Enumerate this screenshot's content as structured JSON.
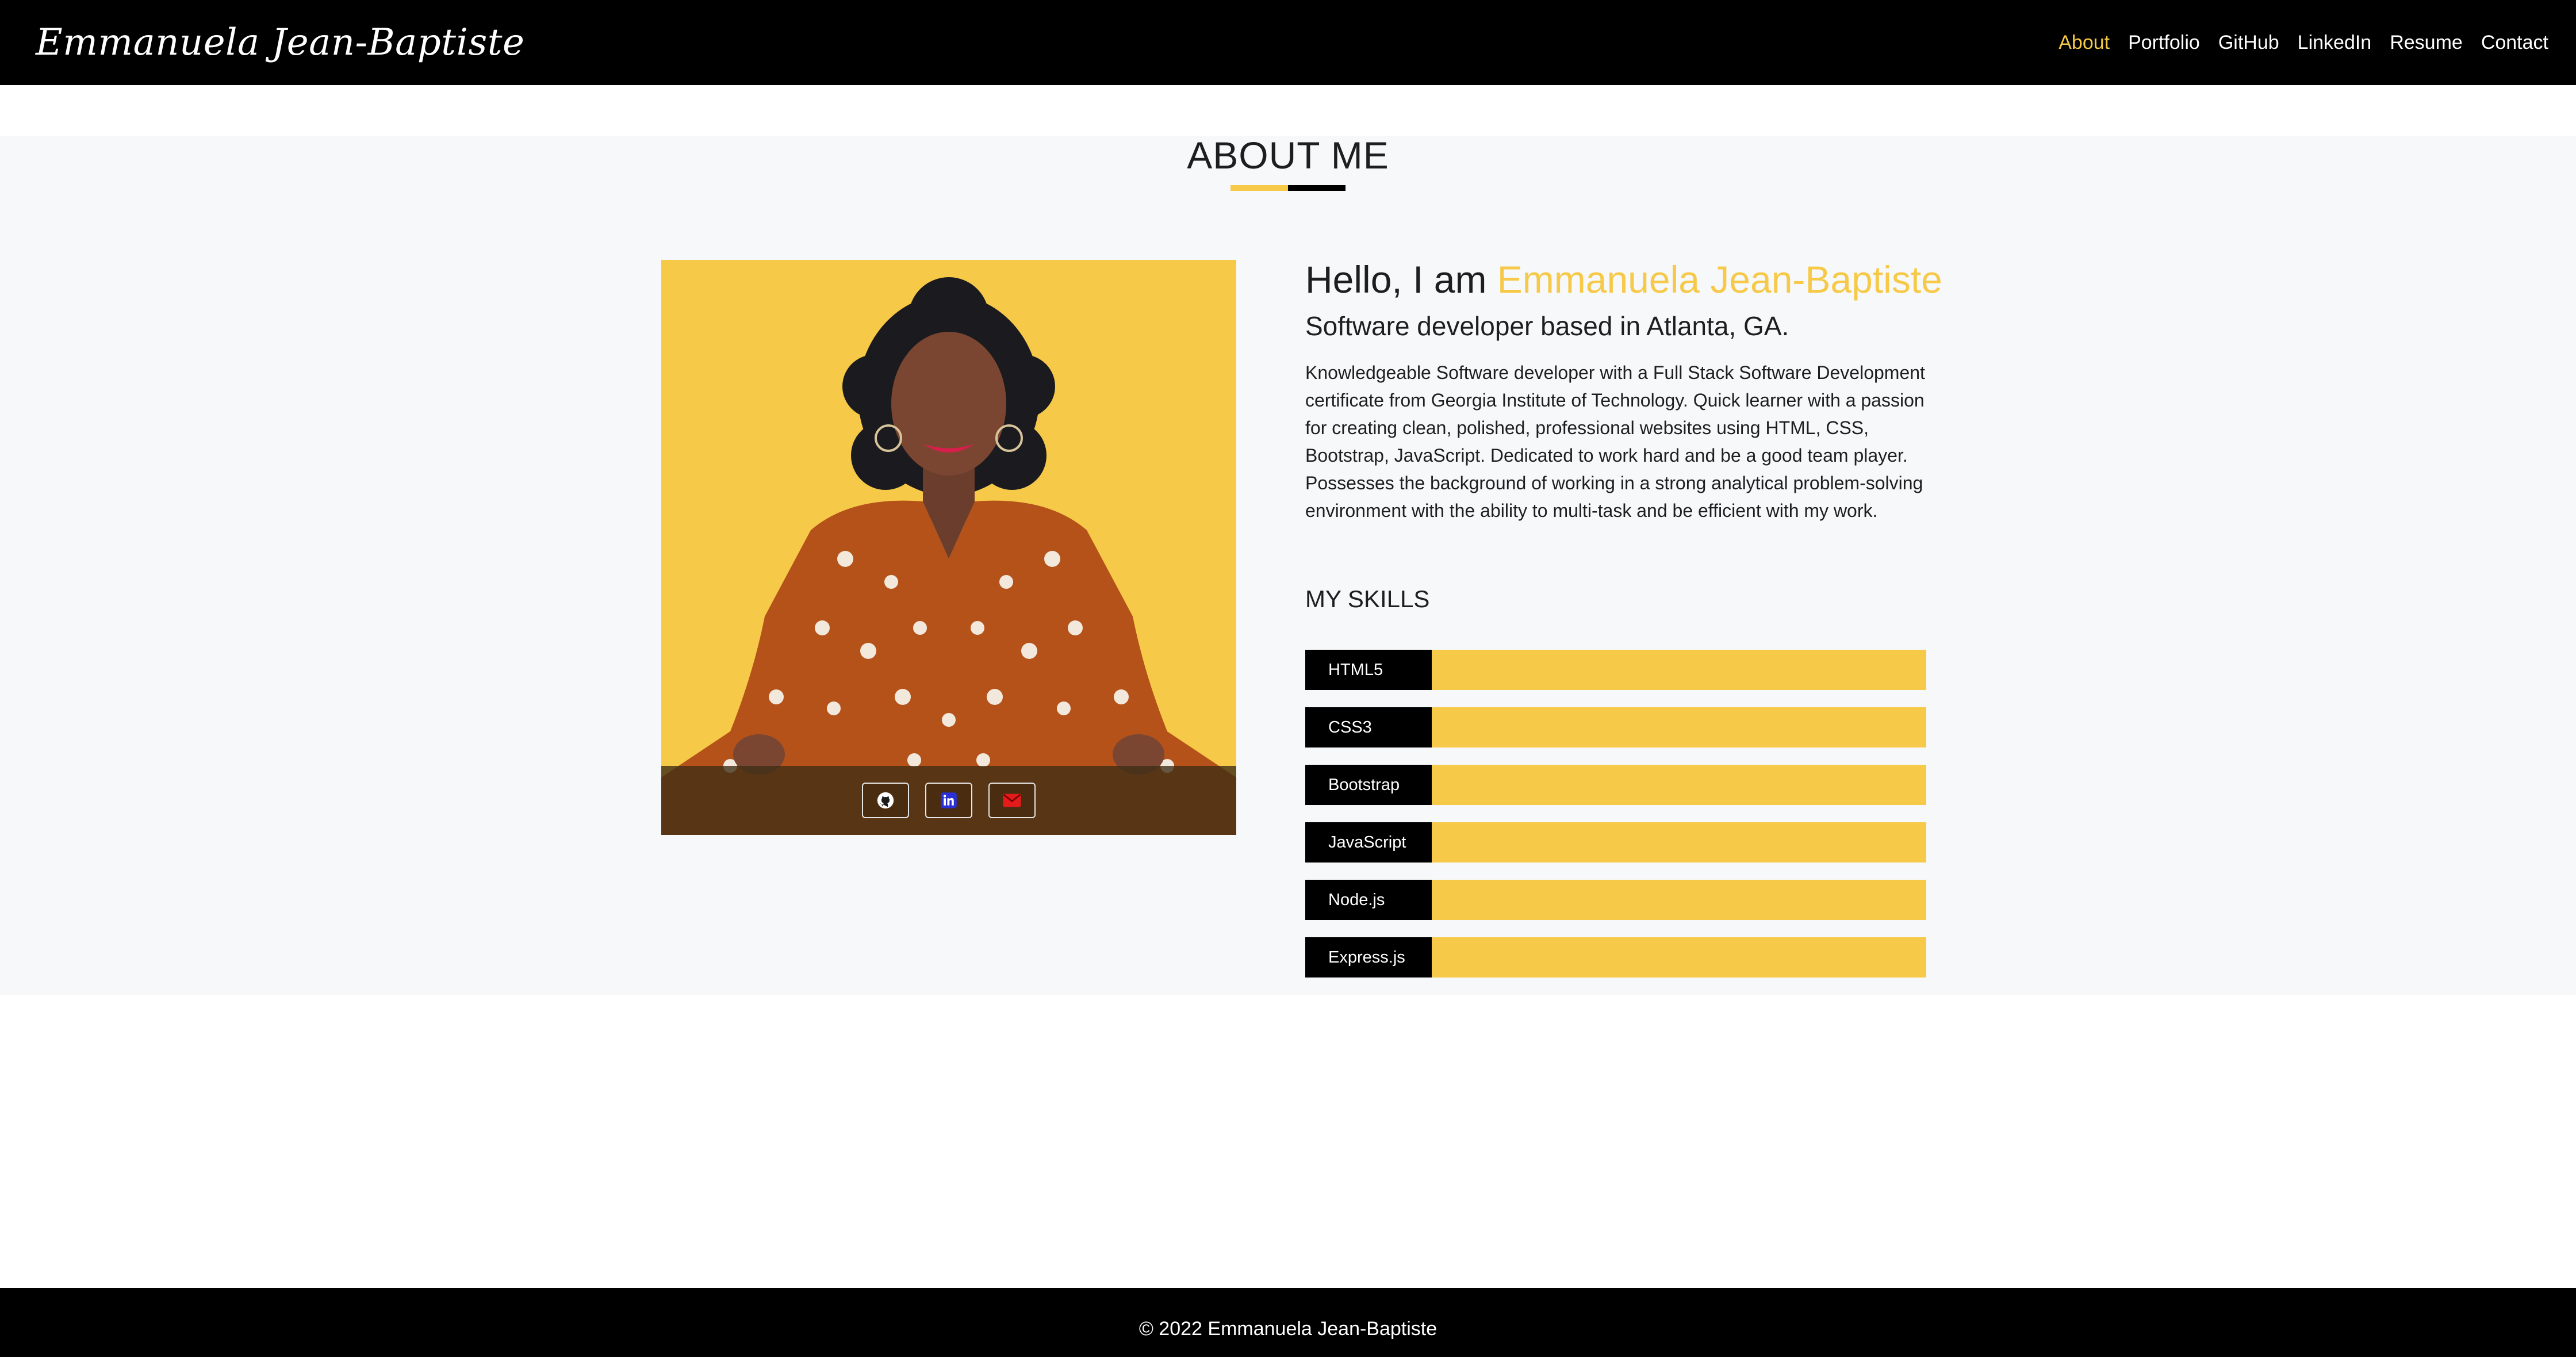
{
  "navbar": {
    "brand": "Emmanuela Jean-Baptiste",
    "links": [
      {
        "label": "About",
        "active": true
      },
      {
        "label": "Portfolio"
      },
      {
        "label": "GitHub"
      },
      {
        "label": "LinkedIn"
      },
      {
        "label": "Resume"
      },
      {
        "label": "Contact"
      }
    ]
  },
  "about": {
    "title": "ABOUT ME",
    "greeting_prefix": "Hello, I am ",
    "greeting_name": "Emmanuela Jean-Baptiste",
    "subtitle": "Software developer based in Atlanta, GA.",
    "bio": "Knowledgeable Software developer with a Full Stack Software Development certificate from Georgia Institute of Technology. Quick learner with a passion for creating clean, polished, professional websites using HTML, CSS, Bootstrap, JavaScript. Dedicated to work hard and be a good team player. Possesses the background of working in a strong analytical problem-solving environment with the ability to multi-task and be efficient with my work.",
    "skills_title": "MY SKILLS",
    "skills": [
      {
        "label": "HTML5"
      },
      {
        "label": "CSS3"
      },
      {
        "label": "Bootstrap"
      },
      {
        "label": "JavaScript"
      },
      {
        "label": "Node.js"
      },
      {
        "label": "Express.js"
      }
    ],
    "social_icons": [
      "github-icon",
      "linkedin-icon",
      "email-icon"
    ]
  },
  "footer": {
    "copyright": "© 2022 Emmanuela Jean-Baptiste"
  },
  "colors": {
    "accent": "#f7c948",
    "navbar_bg": "#000000",
    "section_bg": "#f7f8f9"
  }
}
